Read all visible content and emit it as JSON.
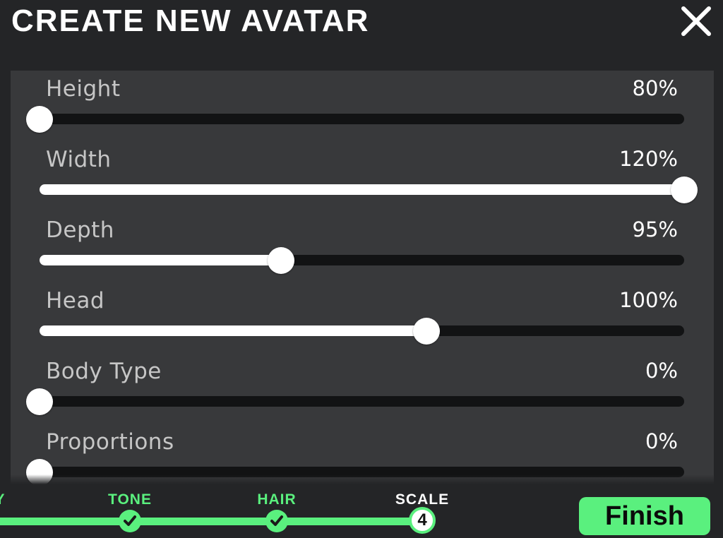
{
  "header": {
    "title": "CREATE NEW AVATAR",
    "close_icon": "close-icon"
  },
  "sliders": [
    {
      "label": "Height",
      "value": "80%",
      "position": 0.0
    },
    {
      "label": "Width",
      "value": "120%",
      "position": 1.0
    },
    {
      "label": "Depth",
      "value": "95%",
      "position": 0.375
    },
    {
      "label": "Head",
      "value": "100%",
      "position": 0.6
    },
    {
      "label": "Body Type",
      "value": "0%",
      "position": 0.0
    },
    {
      "label": "Proportions",
      "value": "0%",
      "position": 0.0
    }
  ],
  "steps": [
    {
      "label": "Y",
      "state": "done",
      "icon": "check-icon"
    },
    {
      "label": "TONE",
      "state": "done",
      "icon": "check-icon"
    },
    {
      "label": "HAIR",
      "state": "done",
      "icon": "check-icon"
    },
    {
      "label": "SCALE",
      "state": "current",
      "number": "4"
    }
  ],
  "finish_label": "Finish",
  "colors": {
    "accent": "#5af07e",
    "background": "#242527",
    "panel": "#38393b",
    "track": "#121314",
    "label": "#c6c6c6",
    "text": "#ffffff"
  }
}
